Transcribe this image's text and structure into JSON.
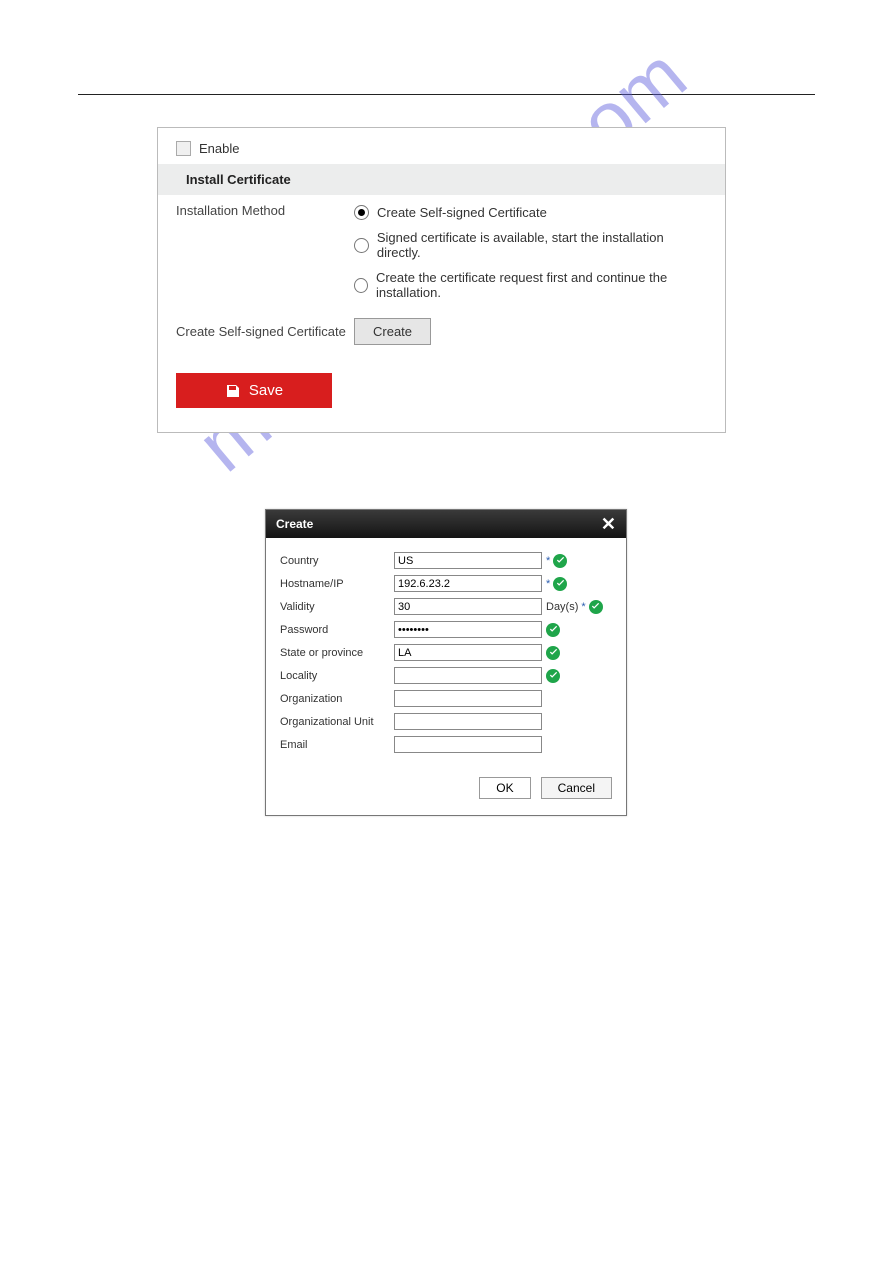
{
  "panel": {
    "enable_label": "Enable",
    "enable_checked": false,
    "section_title": "Install Certificate",
    "install_method_label": "Installation Method",
    "radios": [
      {
        "label": "Create Self-signed Certificate",
        "selected": true
      },
      {
        "label": "Signed certificate is available, start the installation directly.",
        "selected": false
      },
      {
        "label": "Create the certificate request first and continue the installation.",
        "selected": false
      }
    ],
    "create_self_label": "Create Self-signed Certificate",
    "create_button": "Create",
    "save_button": "Save"
  },
  "modal": {
    "title": "Create",
    "fields": [
      {
        "key": "country",
        "label": "Country",
        "type": "text",
        "value": "US",
        "required": true,
        "valid": true
      },
      {
        "key": "hostname",
        "label": "Hostname/IP",
        "type": "text",
        "value": "192.6.23.2",
        "required": true,
        "valid": true
      },
      {
        "key": "validity",
        "label": "Validity",
        "type": "text",
        "value": "30",
        "suffix": "Day(s)",
        "required": true,
        "valid": true
      },
      {
        "key": "password",
        "label": "Password",
        "type": "password",
        "value": "••••••••",
        "required": false,
        "valid": true
      },
      {
        "key": "state",
        "label": "State or province",
        "type": "text",
        "value": "LA",
        "required": false,
        "valid": true
      },
      {
        "key": "locality",
        "label": "Locality",
        "type": "text",
        "value": "",
        "required": false,
        "valid": true
      },
      {
        "key": "organization",
        "label": "Organization",
        "type": "text",
        "value": "",
        "required": false,
        "valid": false
      },
      {
        "key": "org_unit",
        "label": "Organizational Unit",
        "type": "text",
        "value": "",
        "required": false,
        "valid": false
      },
      {
        "key": "email",
        "label": "Email",
        "type": "text",
        "value": "",
        "required": false,
        "valid": false
      }
    ],
    "ok": "OK",
    "cancel": "Cancel"
  },
  "watermark": "manualshive.com"
}
